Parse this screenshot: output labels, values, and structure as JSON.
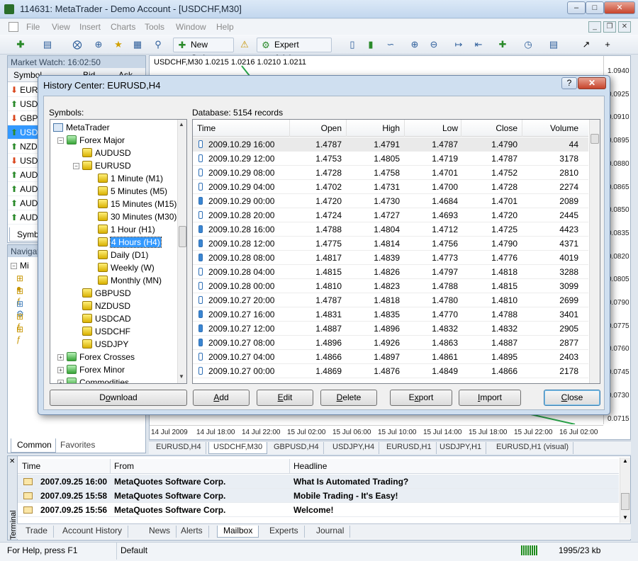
{
  "window": {
    "title": "114631: MetaTrader - Demo Account - [USDCHF,M30]"
  },
  "menu": [
    "File",
    "View",
    "Insert",
    "Charts",
    "Tools",
    "Window",
    "Help"
  ],
  "toolbar": {
    "new_order": "New Order",
    "expert_advisors": "Expert Advisors"
  },
  "market_watch": {
    "title": "Market Watch: 16:02:50",
    "col_symbol": "Symbol",
    "col_bid": "Bid",
    "col_ask": "Ask",
    "symbols": [
      "EUR",
      "USD",
      "GBP",
      "USD",
      "NZD",
      "USD",
      "AUD",
      "AUD",
      "AUD",
      "AUD"
    ],
    "tab": "Symbo"
  },
  "navigator": {
    "title": "Navigat",
    "item": "Mi",
    "tabs": [
      "Common",
      "Favorites"
    ]
  },
  "chart": {
    "info": "USDCHF,M30  1.0215 1.0216 1.0210 1.0211",
    "prices": [
      "1.0940",
      "0.0925",
      "0.0910",
      "0.0895",
      "0.0880",
      "0.0865",
      "0.0850",
      "0.0835",
      "0.0820",
      "0.0805",
      "0.0790",
      "0.0775",
      "0.0760",
      "0.0745",
      "0.0730",
      "0.0715"
    ],
    "times": [
      "14 Jul 2009",
      "14 Jul 18:00",
      "14 Jul 22:00",
      "15 Jul 02:00",
      "15 Jul 06:00",
      "15 Jul 10:00",
      "15 Jul 14:00",
      "15 Jul 18:00",
      "15 Jul 22:00",
      "16 Jul 02:00"
    ],
    "tabs": [
      "EURUSD,H4",
      "USDCHF,M30",
      "GBPUSD,H4",
      "USDJPY,H4",
      "EURUSD,H1",
      "USDJPY,H1",
      "EURUSD,H1 (visual)"
    ]
  },
  "dialog": {
    "title": "History Center: EURUSD,H4",
    "help": "?",
    "symbols_label": "Symbols:",
    "database_label": "Database: 5154 records",
    "tree": [
      {
        "text": "MetaTrader",
        "level": 0,
        "icon": "root"
      },
      {
        "text": "Forex Major",
        "level": 1,
        "icon": "folder",
        "exp": "−"
      },
      {
        "text": "AUDUSD",
        "level": 2,
        "icon": "gold"
      },
      {
        "text": "EURUSD",
        "level": 2,
        "icon": "gold",
        "exp": "−"
      },
      {
        "text": "1 Minute (M1)",
        "level": 3,
        "icon": "gold"
      },
      {
        "text": "5 Minutes (M5)",
        "level": 3,
        "icon": "gold"
      },
      {
        "text": "15 Minutes (M15)",
        "level": 3,
        "icon": "gold"
      },
      {
        "text": "30 Minutes (M30)",
        "level": 3,
        "icon": "gold"
      },
      {
        "text": "1 Hour (H1)",
        "level": 3,
        "icon": "gold"
      },
      {
        "text": "4 Hours (H4)",
        "level": 3,
        "icon": "gold",
        "selected": true
      },
      {
        "text": "Daily (D1)",
        "level": 3,
        "icon": "gold"
      },
      {
        "text": "Weekly (W)",
        "level": 3,
        "icon": "gold"
      },
      {
        "text": "Monthly (MN)",
        "level": 3,
        "icon": "gold"
      },
      {
        "text": "GBPUSD",
        "level": 2,
        "icon": "gold"
      },
      {
        "text": "NZDUSD",
        "level": 2,
        "icon": "gold"
      },
      {
        "text": "USDCAD",
        "level": 2,
        "icon": "gold"
      },
      {
        "text": "USDCHF",
        "level": 2,
        "icon": "gold"
      },
      {
        "text": "USDJPY",
        "level": 2,
        "icon": "gold"
      },
      {
        "text": "Forex Crosses",
        "level": 1,
        "icon": "folder",
        "exp": "+"
      },
      {
        "text": "Forex Minor",
        "level": 1,
        "icon": "folder",
        "exp": "+"
      },
      {
        "text": "Commodities",
        "level": 1,
        "icon": "folder",
        "exp": "+"
      }
    ],
    "columns": [
      "Time",
      "Open",
      "High",
      "Low",
      "Close",
      "Volume"
    ],
    "rows": [
      [
        "2009.10.29 16:00",
        "1.4787",
        "1.4791",
        "1.4787",
        "1.4790",
        "44"
      ],
      [
        "2009.10.29 12:00",
        "1.4753",
        "1.4805",
        "1.4719",
        "1.4787",
        "3178"
      ],
      [
        "2009.10.29 08:00",
        "1.4728",
        "1.4758",
        "1.4701",
        "1.4752",
        "2810"
      ],
      [
        "2009.10.29 04:00",
        "1.4702",
        "1.4731",
        "1.4700",
        "1.4728",
        "2274"
      ],
      [
        "2009.10.29 00:00",
        "1.4720",
        "1.4730",
        "1.4684",
        "1.4701",
        "2089"
      ],
      [
        "2009.10.28 20:00",
        "1.4724",
        "1.4727",
        "1.4693",
        "1.4720",
        "2445"
      ],
      [
        "2009.10.28 16:00",
        "1.4788",
        "1.4804",
        "1.4712",
        "1.4725",
        "4423"
      ],
      [
        "2009.10.28 12:00",
        "1.4775",
        "1.4814",
        "1.4756",
        "1.4790",
        "4371"
      ],
      [
        "2009.10.28 08:00",
        "1.4817",
        "1.4839",
        "1.4773",
        "1.4776",
        "4019"
      ],
      [
        "2009.10.28 04:00",
        "1.4815",
        "1.4826",
        "1.4797",
        "1.4818",
        "3288"
      ],
      [
        "2009.10.28 00:00",
        "1.4810",
        "1.4823",
        "1.4788",
        "1.4815",
        "3099"
      ],
      [
        "2009.10.27 20:00",
        "1.4787",
        "1.4818",
        "1.4780",
        "1.4810",
        "2699"
      ],
      [
        "2009.10.27 16:00",
        "1.4831",
        "1.4835",
        "1.4770",
        "1.4788",
        "3401"
      ],
      [
        "2009.10.27 12:00",
        "1.4887",
        "1.4896",
        "1.4832",
        "1.4832",
        "2905"
      ],
      [
        "2009.10.27 08:00",
        "1.4896",
        "1.4926",
        "1.4863",
        "1.4887",
        "2877"
      ],
      [
        "2009.10.27 04:00",
        "1.4866",
        "1.4897",
        "1.4861",
        "1.4895",
        "2403"
      ],
      [
        "2009.10.27 00:00",
        "1.4869",
        "1.4876",
        "1.4849",
        "1.4866",
        "2178"
      ]
    ],
    "buttons": {
      "download": "Download",
      "add": "Add",
      "edit": "Edit",
      "delete": "Delete",
      "export": "Export",
      "import": "Import",
      "close": "Close"
    }
  },
  "terminal": {
    "side_label": "Terminal",
    "columns": [
      "Time",
      "From",
      "Headline"
    ],
    "rows": [
      [
        "2007.09.25 16:00",
        "MetaQuotes Software Corp.",
        "What Is Automated Trading?"
      ],
      [
        "2007.09.25 15:58",
        "MetaQuotes Software Corp.",
        "Mobile Trading - It's Easy!"
      ],
      [
        "2007.09.25 15:56",
        "MetaQuotes Software Corp.",
        "Welcome!"
      ]
    ],
    "tabs": [
      "Trade",
      "Account History",
      "News",
      "Alerts",
      "Mailbox",
      "Experts",
      "Journal"
    ],
    "active_tab": "Mailbox"
  },
  "status": {
    "help": "For Help, press F1",
    "profile": "Default",
    "traffic": "1995/23 kb"
  }
}
